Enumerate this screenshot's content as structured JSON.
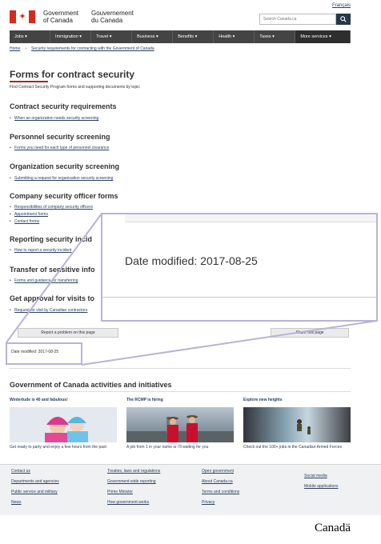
{
  "header": {
    "language_link": "Français",
    "brand_en": "Government\nof Canada",
    "brand_fr": "Gouvernement\ndu Canada",
    "search_placeholder": "Search Canada.ca",
    "search_icon": "search-icon"
  },
  "menu": [
    "Jobs",
    "Immigration",
    "Travel",
    "Business",
    "Benefits",
    "Health",
    "Taxes",
    "More services"
  ],
  "breadcrumb": [
    "Home",
    "Security requirements for contracting with the Government of Canada"
  ],
  "page": {
    "title": "Forms for contract security",
    "intro": "Find Contract Security Program forms and supporting documents by topic"
  },
  "sections": [
    {
      "heading": "Contract security requirements",
      "items": [
        "When an organization needs security screening"
      ]
    },
    {
      "heading": "Personnel security screening",
      "items": [
        "Forms you need for each type of personnel clearance"
      ]
    },
    {
      "heading": "Organization security screening",
      "items": [
        "Submitting a request for organization security screening"
      ]
    },
    {
      "heading": "Company security officer forms",
      "items": [
        "Responsibilities of company security officers",
        "Appointment forms",
        "Contact forms"
      ]
    },
    {
      "heading": "Reporting security incid",
      "items": [
        "How to report a security incident"
      ]
    },
    {
      "heading": "Transfer of sensitive info",
      "items": [
        "Forms and guidance for transferring"
      ]
    },
    {
      "heading": "Get approval for visits to",
      "items": [
        "Request for visit by Canadian contractors"
      ]
    }
  ],
  "actions": {
    "report": "Report a problem on this page",
    "share": "Share this page"
  },
  "date_modified_small": "Date modified: 2017-08-25",
  "zoom": {
    "date_modified": "Date modified: 2017-08-25"
  },
  "features": {
    "heading": "Government of Canada activities and initiatives",
    "cards": [
      {
        "title": "Wintertude is 40 and fabulous!",
        "caption": "Get ready to party and enjoy a few hours from the past"
      },
      {
        "title": "The RCMP is hiring",
        "caption": "A job from 1 in your name or I'll waiting for you"
      },
      {
        "title": "Explore new heights",
        "caption": "Check out the 100+ jobs in the Canadian Armed Forces"
      }
    ]
  },
  "footer": {
    "col1": [
      "Contact us",
      "Departments and agencies",
      "Public service and military",
      "News"
    ],
    "col2": [
      "Treaties, laws and regulations",
      "Government-wide reporting",
      "Prime Minister",
      "How government works"
    ],
    "col3": [
      "Open government",
      "About Canada.ca",
      "Terms and conditions",
      "Privacy"
    ],
    "col4": [
      "Social media",
      "Mobile applications"
    ],
    "wordmark": "Canadä"
  }
}
